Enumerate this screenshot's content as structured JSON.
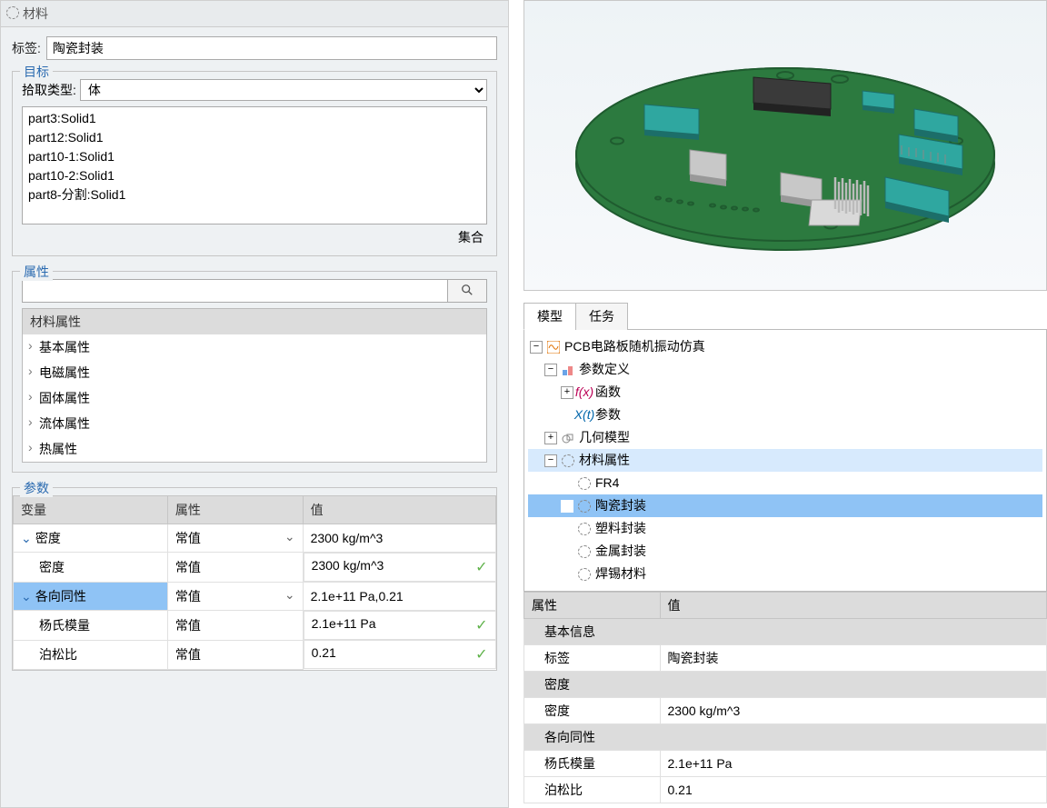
{
  "left": {
    "title": "材料",
    "label_field": "标签:",
    "label_value": "陶瓷封装",
    "target": {
      "legend": "目标",
      "pick_label": "拾取类型:",
      "pick_value": "体",
      "items": [
        "part3:Solid1",
        "part12:Solid1",
        "part10-1:Solid1",
        "part10-2:Solid1",
        "part8-分割:Solid1"
      ],
      "collect": "集合"
    },
    "properties": {
      "legend": "属性",
      "header": "材料属性",
      "items": [
        "基本属性",
        "电磁属性",
        "固体属性",
        "流体属性",
        "热属性"
      ]
    },
    "params": {
      "legend": "参数",
      "headers": [
        "变量",
        "属性",
        "值"
      ],
      "rows": [
        {
          "type": "group",
          "open": true,
          "col1": "密度",
          "col2": "常值",
          "dd": true,
          "col3": "2300 kg/m^3"
        },
        {
          "type": "row",
          "col1": "密度",
          "col2": "常值",
          "col3": "2300 kg/m^3",
          "check": true
        },
        {
          "type": "group",
          "open": true,
          "blue": true,
          "col1": "各向同性",
          "col2": "常值",
          "dd": true,
          "col3": "2.1e+11 Pa,0.21"
        },
        {
          "type": "row",
          "col1": "杨氏模量",
          "col2": "常值",
          "col3": "2.1e+11 Pa",
          "check": true
        },
        {
          "type": "row",
          "col1": "泊松比",
          "col2": "常值",
          "col3": "0.21",
          "check": true
        }
      ]
    }
  },
  "right": {
    "tabs": {
      "model": "模型",
      "task": "任务"
    },
    "tree": {
      "root": "PCB电路板随机振动仿真",
      "paramdef": "参数定义",
      "func": "函数",
      "params": "参数",
      "geom": "几何模型",
      "matprop": "材料属性",
      "materials": [
        "FR4",
        "陶瓷封装",
        "塑料封装",
        "金属封装",
        "焊锡材料"
      ],
      "selected_index": 1
    },
    "prop_table": {
      "headers": [
        "属性",
        "值"
      ],
      "sections": [
        {
          "title": "基本信息",
          "rows": [
            {
              "k": "标签",
              "v": "陶瓷封装"
            }
          ]
        },
        {
          "title": "密度",
          "rows": [
            {
              "k": "密度",
              "v": "2300 kg/m^3"
            }
          ]
        },
        {
          "title": "各向同性",
          "rows": [
            {
              "k": "杨氏模量",
              "v": "2.1e+11 Pa"
            },
            {
              "k": "泊松比",
              "v": "0.21"
            }
          ]
        }
      ]
    }
  },
  "icons": {
    "fx": "f(x)",
    "xt": "X(t)"
  }
}
